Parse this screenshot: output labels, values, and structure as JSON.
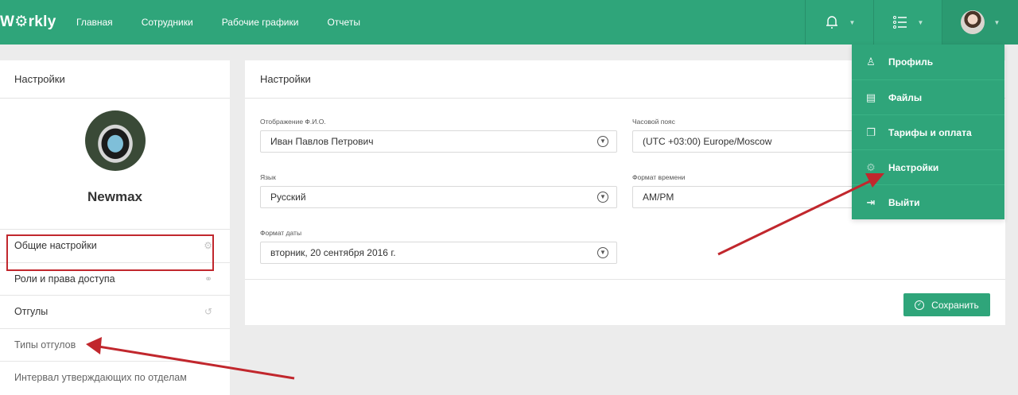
{
  "header": {
    "logo": "W⚙rkly",
    "nav": [
      "Главная",
      "Сотрудники",
      "Рабочие графики",
      "Отчеты"
    ]
  },
  "dropdown": {
    "items": [
      {
        "label": "Профиль",
        "icon": "user-icon"
      },
      {
        "label": "Файлы",
        "icon": "files-icon"
      },
      {
        "label": "Тарифы и оплата",
        "icon": "copy-icon"
      },
      {
        "label": "Настройки",
        "icon": "gear-icon"
      },
      {
        "label": "Выйти",
        "icon": "logout-icon"
      }
    ]
  },
  "sidebar": {
    "title": "Настройки",
    "user_name": "Newmax",
    "items": [
      {
        "label": "Общие настройки",
        "icon": "gear-icon"
      },
      {
        "label": "Роли и права доступа",
        "icon": "roles-icon"
      },
      {
        "label": "Отгулы",
        "icon": "history-icon"
      },
      {
        "label": "Типы отгулов"
      },
      {
        "label": "Интервал утверждающих по отделам"
      }
    ]
  },
  "main": {
    "title": "Настройки",
    "fields": {
      "fio_label": "Отображение Ф.И.О.",
      "fio_value": "Иван Павлов Петрович",
      "tz_label": "Часовой пояс",
      "tz_value": "(UTC +03:00) Europe/Moscow",
      "lang_label": "Язык",
      "lang_value": "Русский",
      "time_label": "Формат времени",
      "time_value": "AM/PM",
      "date_label": "Формат даты",
      "date_value": "вторник, 20 сентября 2016 г."
    },
    "save_label": "Сохранить"
  },
  "colors": {
    "brand": "#2fa57a",
    "annotation": "#c1272d"
  }
}
